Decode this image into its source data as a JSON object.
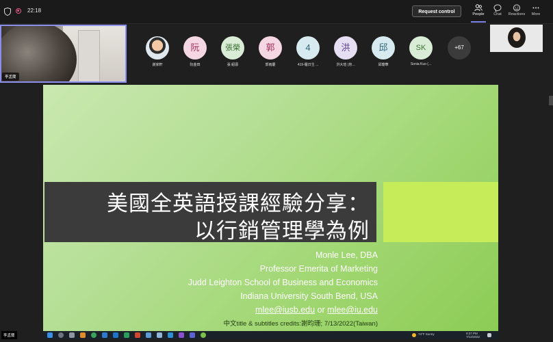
{
  "meeting": {
    "timer": "22:18",
    "request_control_label": "Request control",
    "toolbar": [
      {
        "label": "People",
        "icon": "people-icon"
      },
      {
        "label": "Chat",
        "icon": "chat-icon"
      },
      {
        "label": "Reactions",
        "icon": "reactions-icon"
      },
      {
        "label": "More",
        "icon": "more-icon"
      }
    ]
  },
  "self_video": {
    "name": "李孟蘭"
  },
  "participants": [
    {
      "initials": "",
      "name": "謝家軒",
      "color": "#dfe7ef"
    },
    {
      "initials": "阮",
      "name": "阮金田",
      "color": "#f4d7e3",
      "text_color": "#a0305a"
    },
    {
      "initials": "張榮",
      "name": "張 紹源",
      "color": "#d9ecd6",
      "text_color": "#3e6e35"
    },
    {
      "initials": "郭",
      "name": "郭雨慶",
      "color": "#f4d7e3",
      "text_color": "#a0305a"
    },
    {
      "initials": "4",
      "name": "419-羅日生 ...",
      "color": "#d6eaf0",
      "text_color": "#2f6575"
    },
    {
      "initials": "洪",
      "name": "洪大瑄 (帛...",
      "color": "#e6def2",
      "text_color": "#5b3f8a"
    },
    {
      "initials": "邱",
      "name": "邱瓊華",
      "color": "#d6eaf0",
      "text_color": "#2f6575"
    },
    {
      "initials": "SK",
      "name": "Sonia Kuo (...",
      "color": "#d9ecd6",
      "text_color": "#3e6e35"
    }
  ],
  "more_participants": "+67",
  "slide": {
    "title_line1": "美國全英語授課經驗分享：",
    "title_line2": "以行銷管理學為例",
    "presenter": "Monle Lee, DBA",
    "position": "Professor Emerita of Marketing",
    "school": "Judd Leighton School of Business and Economics",
    "university": "Indiana University South Bend, USA",
    "email1": "mlee@iusb.edu",
    "email_or": " or ",
    "email2": "mlee@iu.edu",
    "credits": "中文title & subtitles credits:謝昀珊; 7/13/2022(Taiwan)"
  },
  "taskbar": {
    "weather": "74°F  Sunny",
    "time": "9:37 PM",
    "date": "7/12/2022"
  },
  "bottom_label": "李孟蘭"
}
